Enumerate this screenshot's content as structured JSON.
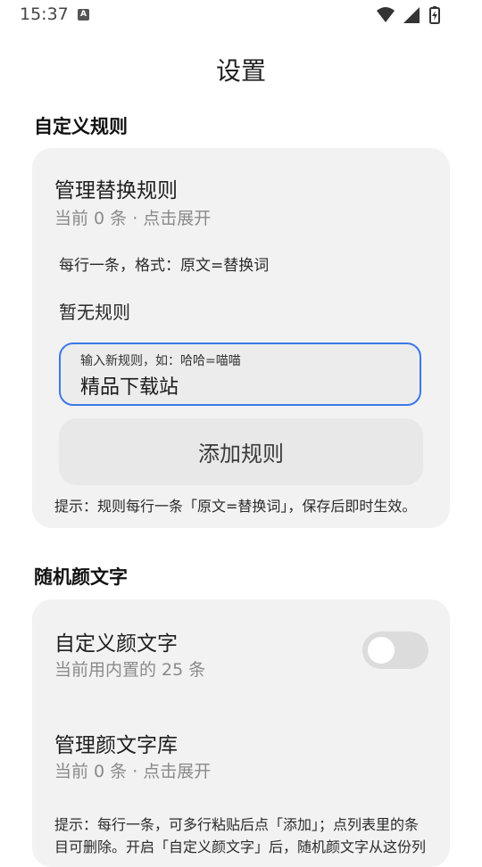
{
  "status": {
    "time": "15:37",
    "badge": "A"
  },
  "page": {
    "title": "设置"
  },
  "sections": [
    {
      "title": "自定义规则",
      "manage": {
        "title": "管理替换规则",
        "subtitle": "当前 0 条 · 点击展开"
      },
      "format_text": "每行一条，格式：原文=替换词",
      "empty_text": "暂无规则",
      "input": {
        "label": "输入新规则，如：哈哈=喵喵",
        "value": "精品下载站"
      },
      "add_button": "添加规则",
      "hint": "提示：规则每行一条「原文=替换词」，保存后即时生效。"
    },
    {
      "title": "随机颜文字",
      "custom": {
        "title": "自定义颜文字",
        "subtitle": "当前用内置的 25 条",
        "enabled": false
      },
      "manage": {
        "title": "管理颜文字库",
        "subtitle": "当前 0 条 · 点击展开"
      },
      "hint_line1": "提示：每行一条，可多行粘贴后点「添加」；点列表里的条",
      "hint_line2": "目可删除。开启「自定义颜文字」后，随机颜文字从这份列"
    }
  ],
  "colors": {
    "accent": "#3b78e7",
    "card": "#f2f2f2"
  }
}
